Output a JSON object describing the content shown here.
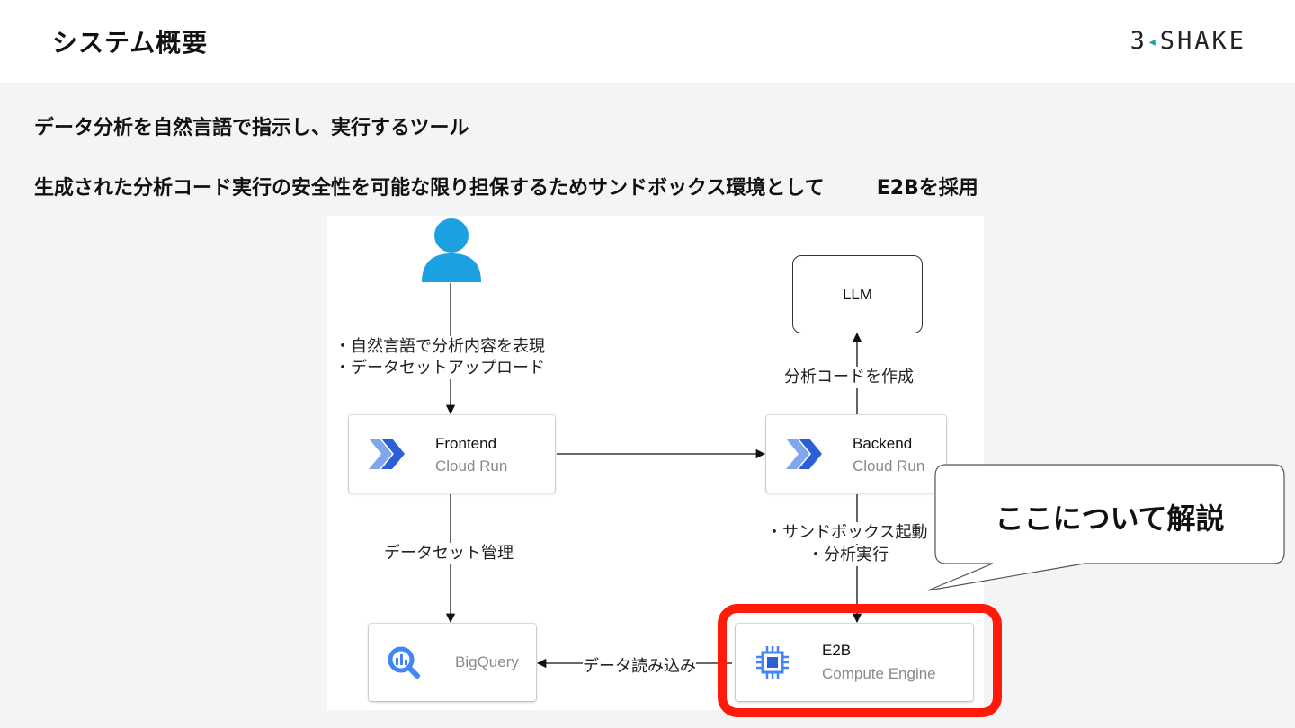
{
  "header": {
    "title": "システム概要",
    "logo_text_left": "3",
    "logo_mark": "◂",
    "logo_text_right": "SHAKE"
  },
  "body": {
    "line1": "データ分析を自然言語で指示し、実行するツール",
    "line2_main": "生成された分析コード実行の安全性を可能な限り担保するためサンドボックス環境として",
    "line2_tail": "E2Bを採用"
  },
  "diagram": {
    "user_icon": "user-icon",
    "llm_label": "LLM",
    "frontend": {
      "title": "Frontend",
      "subtitle": "Cloud Run",
      "icon": "cloud-run-icon"
    },
    "backend": {
      "title": "Backend",
      "subtitle": "Cloud Run",
      "icon": "cloud-run-icon"
    },
    "bigquery": {
      "title": "BigQuery",
      "icon": "bigquery-icon"
    },
    "e2b": {
      "title": "E2B",
      "subtitle": "Compute Engine",
      "icon": "compute-engine-icon"
    },
    "edge_user_frontend": [
      "・自然言語で分析内容を表現",
      "・データセットアップロード"
    ],
    "edge_backend_llm": "分析コードを作成",
    "edge_frontend_bigquery": "データセット管理",
    "edge_backend_e2b": [
      "・サンドボックス起動",
      "・分析実行"
    ],
    "edge_e2b_bigquery": "データ読み込み"
  },
  "callout": {
    "text": "ここについて解説"
  },
  "colors": {
    "highlight": "#ff1a0a",
    "cloud_run_dark": "#2a5fd6",
    "cloud_run_light": "#7fa6ef",
    "user_icon": "#1ba1e2",
    "bigquery": "#4285f4",
    "logo_mark": "#1aa6a0"
  }
}
